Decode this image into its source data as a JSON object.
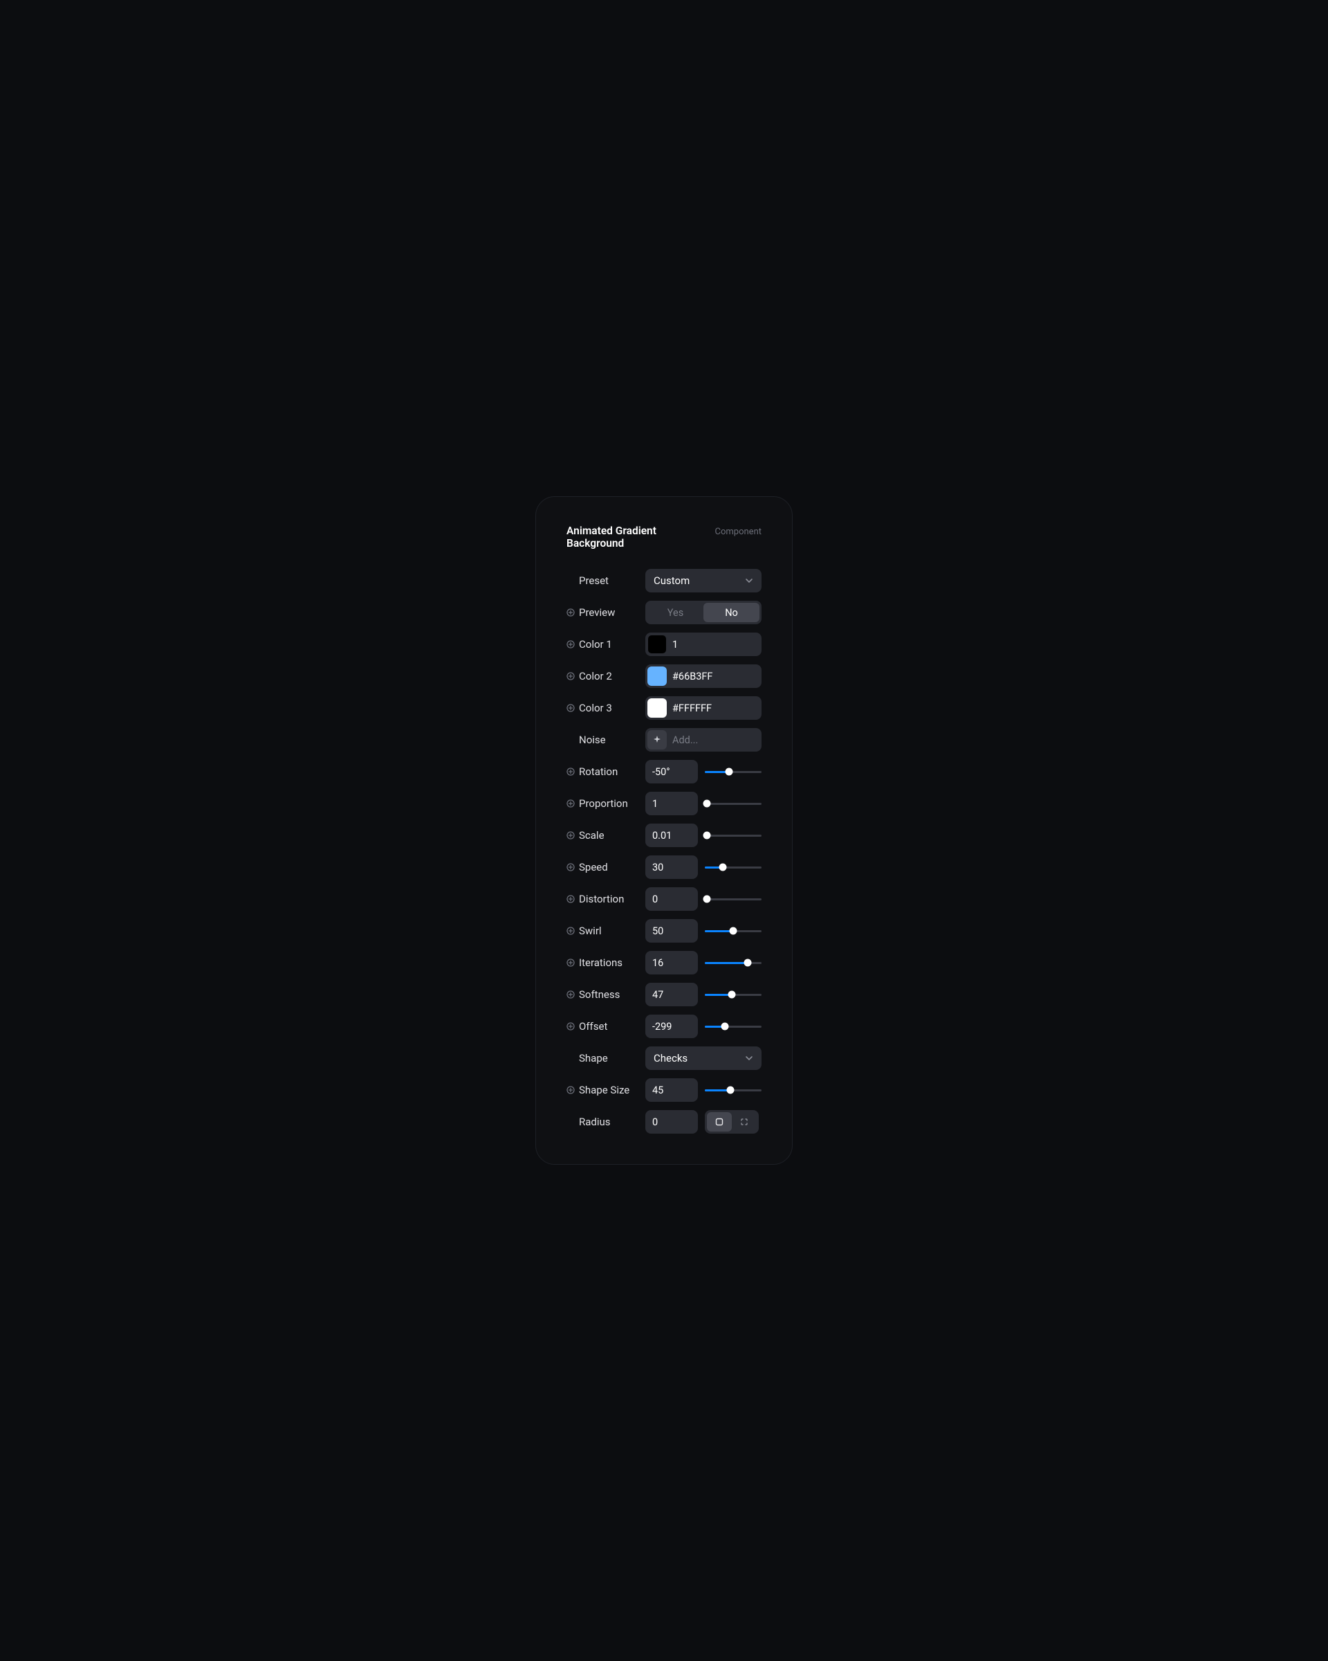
{
  "header": {
    "title": "Animated Gradient Background",
    "subtitle": "Component"
  },
  "preset": {
    "label": "Preset",
    "value": "Custom"
  },
  "preview": {
    "label": "Preview",
    "yes": "Yes",
    "no": "No"
  },
  "color1": {
    "label": "Color 1",
    "value": "1",
    "swatch": "#000000"
  },
  "color2": {
    "label": "Color 2",
    "value": "#66B3FF",
    "swatch": "#66B3FF"
  },
  "color3": {
    "label": "Color 3",
    "value": "#FFFFFF",
    "swatch": "#FFFFFF"
  },
  "noise": {
    "label": "Noise",
    "placeholder": "Add..."
  },
  "rotation": {
    "label": "Rotation",
    "value": "-50°",
    "pct": 43
  },
  "proportion": {
    "label": "Proportion",
    "value": "1",
    "pct": 4
  },
  "scale": {
    "label": "Scale",
    "value": "0.01",
    "pct": 4
  },
  "speed": {
    "label": "Speed",
    "value": "30",
    "pct": 32
  },
  "distortion": {
    "label": "Distortion",
    "value": "0",
    "pct": 4
  },
  "swirl": {
    "label": "Swirl",
    "value": "50",
    "pct": 50
  },
  "iterations": {
    "label": "Iterations",
    "value": "16",
    "pct": 75
  },
  "softness": {
    "label": "Softness",
    "value": "47",
    "pct": 47
  },
  "offset": {
    "label": "Offset",
    "value": "-299",
    "pct": 35
  },
  "shape": {
    "label": "Shape",
    "value": "Checks"
  },
  "shapeSize": {
    "label": "Shape Size",
    "value": "45",
    "pct": 45
  },
  "radius": {
    "label": "Radius",
    "value": "0"
  }
}
